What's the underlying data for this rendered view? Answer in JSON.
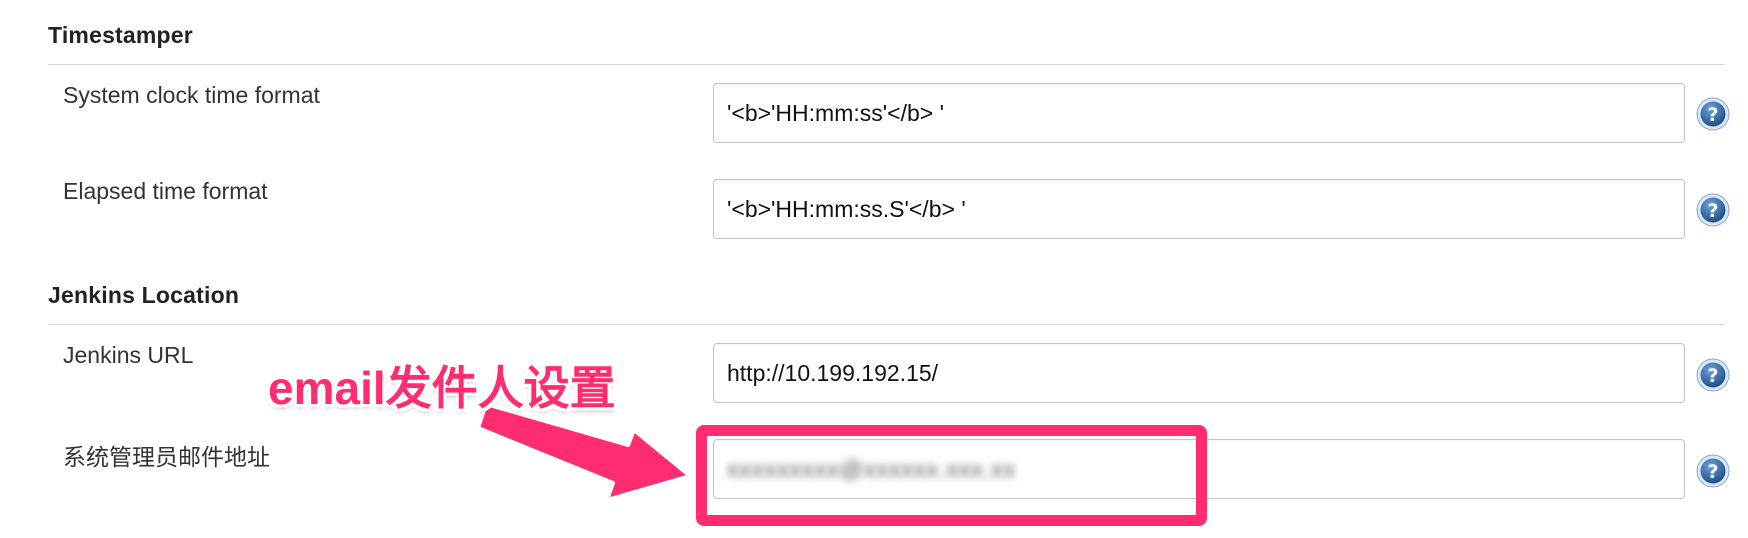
{
  "sections": [
    {
      "title": "Timestamper",
      "fields": [
        {
          "label": "System clock time format",
          "value": "'<b>'HH:mm:ss'</b> '"
        },
        {
          "label": "Elapsed time format",
          "value": "'<b>'HH:mm:ss.S'</b> '"
        }
      ]
    },
    {
      "title": "Jenkins Location",
      "fields": [
        {
          "label": "Jenkins URL",
          "value": "http://10.199.192.15/"
        },
        {
          "label": "系统管理员邮件地址",
          "value": "xxxxxxxxx@xxxxxx.xxx.xx"
        }
      ]
    }
  ],
  "annotation": {
    "text": "email发件人设置",
    "color": "#ff2d6f"
  },
  "icons": {
    "help": "help-question-icon"
  },
  "colors": {
    "help_icon": "#2a5c97",
    "input_border": "#c4c4c4"
  }
}
